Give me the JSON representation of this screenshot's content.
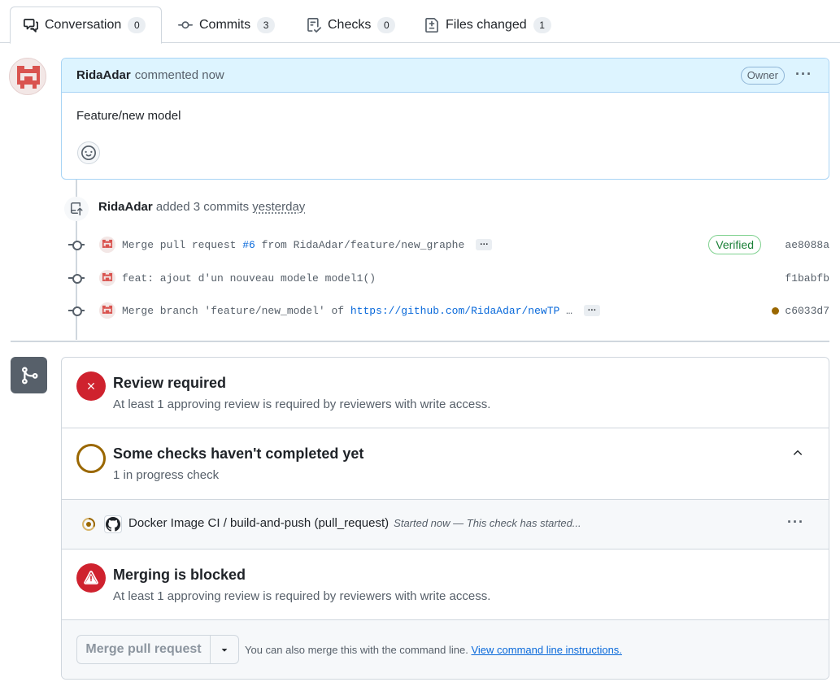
{
  "tabs": [
    {
      "label": "Conversation",
      "count": "0",
      "icon": "comment-discussion-icon"
    },
    {
      "label": "Commits",
      "count": "3",
      "icon": "git-commit-icon"
    },
    {
      "label": "Checks",
      "count": "0",
      "icon": "checklist-icon"
    },
    {
      "label": "Files changed",
      "count": "1",
      "icon": "file-diff-icon"
    }
  ],
  "comment": {
    "author": "RidaAdar",
    "meta": "commented now",
    "badge": "Owner",
    "more": "···",
    "body": "Feature/new model"
  },
  "push_event": {
    "author": "RidaAdar",
    "action": "added 3 commits",
    "when": "yesterday"
  },
  "commits": [
    {
      "message_prefix": "Merge pull request ",
      "link": "#6",
      "message_suffix": " from RidaAdar/feature/new_graphe",
      "expand": "…",
      "verified": "Verified",
      "sha": "ae8088a"
    },
    {
      "message": "feat: ajout d'un nouveau modele model1()",
      "sha": "f1babfb"
    },
    {
      "message_prefix": "Merge branch 'feature/new_model' of ",
      "link": "https://github.com/RidaAdar/newTP",
      "message_suffix": " …",
      "expand": "…",
      "status_color": "#9a6700",
      "sha": "c6033d7"
    }
  ],
  "merge": {
    "review": {
      "title": "Review required",
      "subtitle": "At least 1 approving review is required by reviewers with write access."
    },
    "checks": {
      "title": "Some checks haven't completed yet",
      "subtitle": "1 in progress check"
    },
    "check_item": {
      "name": "Docker Image CI / build-and-push (pull_request)",
      "description": "Started now — This check has started...",
      "more": "···"
    },
    "blocked": {
      "title": "Merging is blocked",
      "subtitle": "At least 1 approving review is required by reviewers with write access."
    },
    "footer": {
      "button": "Merge pull request",
      "hint": "You can also merge this with the command line.",
      "hint_link": "View command line instructions."
    }
  },
  "colors": {
    "accent": "#0969da",
    "danger": "#cf222e",
    "pending": "#9a6700",
    "success": "#1a7f37"
  }
}
